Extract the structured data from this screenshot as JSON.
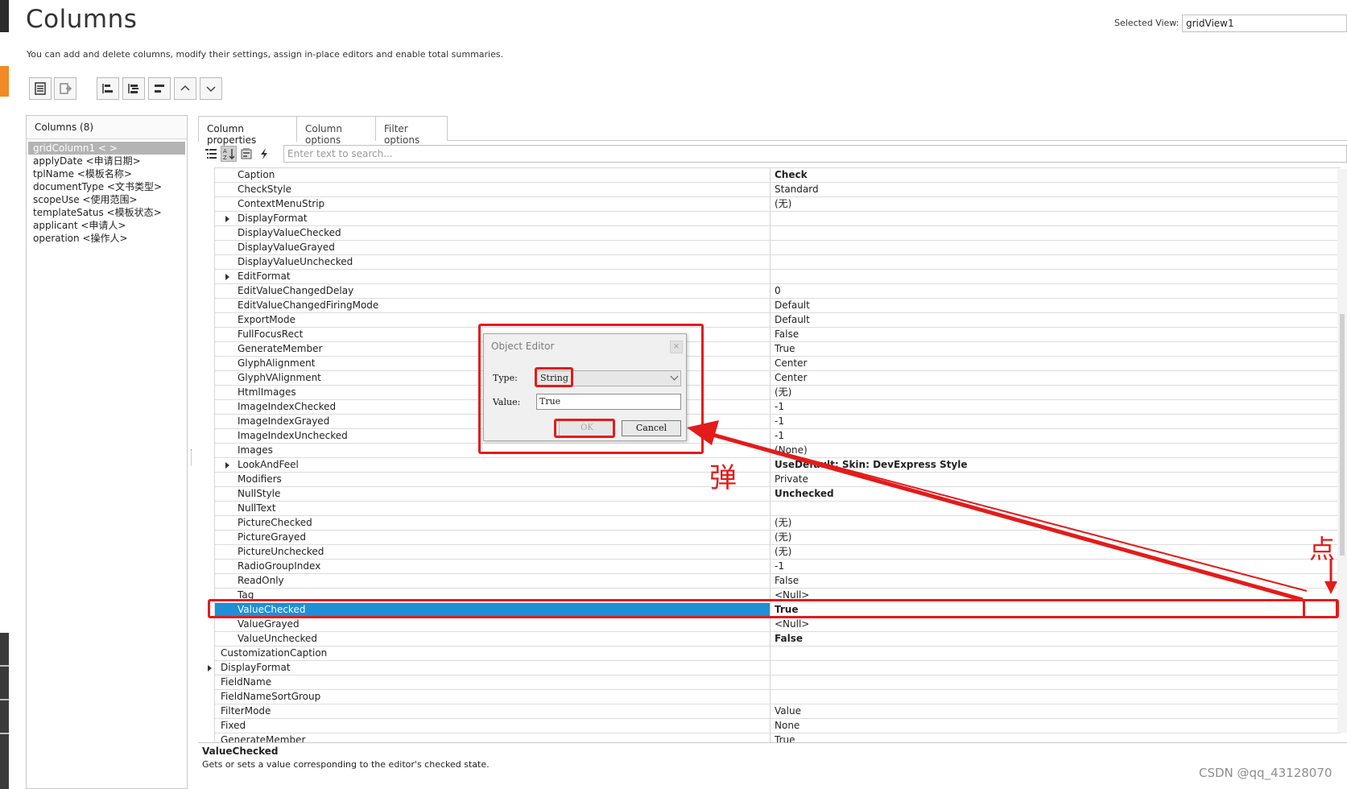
{
  "page": {
    "title": "Columns",
    "description": "You can add and delete columns, modify their settings, assign in-place editors and enable total summaries.",
    "selected_view_label": "Selected View:",
    "selected_view_value": "gridView1"
  },
  "columns_panel": {
    "header": "Columns (8)",
    "items": [
      "gridColumn1 < >",
      "applyDate <申请日期>",
      "tplName <模板名称>",
      "documentType <文书类型>",
      "scopeUse <使用范围>",
      "templateSatus <模板状态>",
      "applicant <申请人>",
      "operation <操作人>"
    ]
  },
  "tabs": [
    "Column properties",
    "Column options",
    "Filter options"
  ],
  "search": {
    "placeholder": "Enter text to search..."
  },
  "properties": [
    {
      "name": "Caption",
      "value": "Check",
      "bold": true
    },
    {
      "name": "CheckStyle",
      "value": "Standard"
    },
    {
      "name": "ContextMenuStrip",
      "value": "(无)"
    },
    {
      "name": "DisplayFormat",
      "value": "",
      "expandable": true
    },
    {
      "name": "DisplayValueChecked",
      "value": ""
    },
    {
      "name": "DisplayValueGrayed",
      "value": ""
    },
    {
      "name": "DisplayValueUnchecked",
      "value": ""
    },
    {
      "name": "EditFormat",
      "value": "",
      "expandable": true
    },
    {
      "name": "EditValueChangedDelay",
      "value": "0"
    },
    {
      "name": "EditValueChangedFiringMode",
      "value": "Default"
    },
    {
      "name": "ExportMode",
      "value": "Default"
    },
    {
      "name": "FullFocusRect",
      "value": "False"
    },
    {
      "name": "GenerateMember",
      "value": "True"
    },
    {
      "name": "GlyphAlignment",
      "value": "Center"
    },
    {
      "name": "GlyphVAlignment",
      "value": "Center"
    },
    {
      "name": "HtmlImages",
      "value": "(无)"
    },
    {
      "name": "ImageIndexChecked",
      "value": "-1"
    },
    {
      "name": "ImageIndexGrayed",
      "value": "-1"
    },
    {
      "name": "ImageIndexUnchecked",
      "value": "-1"
    },
    {
      "name": "Images",
      "value": "(None)"
    },
    {
      "name": "LookAndFeel",
      "value": "UseDefault; Skin: DevExpress Style",
      "bold": true,
      "expandable": true
    },
    {
      "name": "Modifiers",
      "value": "Private"
    },
    {
      "name": "NullStyle",
      "value": "Unchecked",
      "bold": true
    },
    {
      "name": "NullText",
      "value": ""
    },
    {
      "name": "PictureChecked",
      "value": "(无)"
    },
    {
      "name": "PictureGrayed",
      "value": "(无)"
    },
    {
      "name": "PictureUnchecked",
      "value": "(无)"
    },
    {
      "name": "RadioGroupIndex",
      "value": "-1"
    },
    {
      "name": "ReadOnly",
      "value": "False"
    },
    {
      "name": "Tag",
      "value": "<Null>"
    },
    {
      "name": "ValueChecked",
      "value": "True",
      "bold": true,
      "selected": true
    },
    {
      "name": "ValueGrayed",
      "value": "<Null>"
    },
    {
      "name": "ValueUnchecked",
      "value": "False",
      "bold": true
    },
    {
      "name": "CustomizationCaption",
      "value": "",
      "top": true
    },
    {
      "name": "DisplayFormat",
      "value": "",
      "top": true,
      "expandable": true
    },
    {
      "name": "FieldName",
      "value": "",
      "top": true
    },
    {
      "name": "FieldNameSortGroup",
      "value": "",
      "top": true
    },
    {
      "name": "FilterMode",
      "value": "Value",
      "top": true
    },
    {
      "name": "Fixed",
      "value": "None",
      "top": true
    },
    {
      "name": "GenerateMember",
      "value": "True",
      "top": true
    }
  ],
  "description_area": {
    "title": "ValueChecked",
    "text": "Gets or sets a value corresponding to the editor's checked state."
  },
  "dialog": {
    "title": "Object Editor",
    "close_glyph": "×",
    "type_label": "Type:",
    "type_value": "String",
    "value_label": "Value:",
    "value_value": "True",
    "ok_label": "OK",
    "cancel_label": "Cancel"
  },
  "annotations": {
    "popup_char": "弹",
    "click_char": "点",
    "color": "#e31b1b"
  },
  "watermark": "CSDN @qq_43128070",
  "colors": {
    "selection": "#1f8fd6",
    "annotation_red": "#e31b1b"
  }
}
